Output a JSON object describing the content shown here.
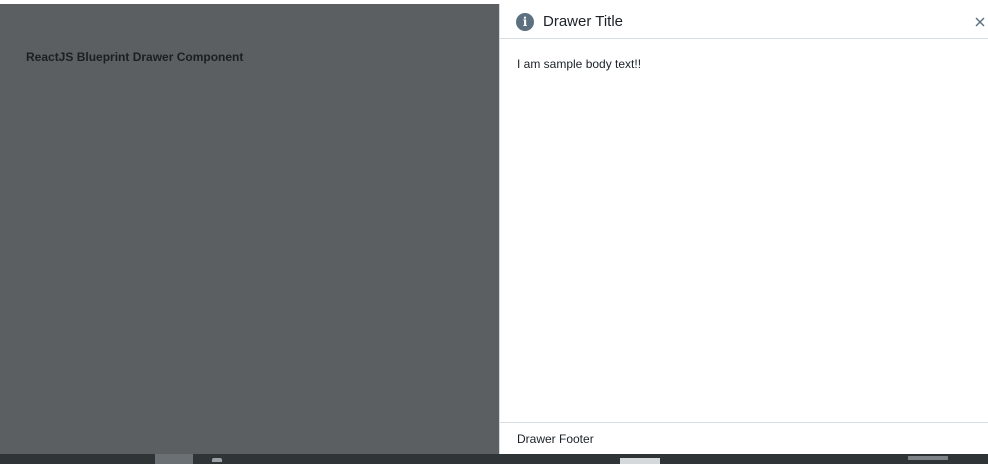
{
  "page": {
    "heading": "ReactJS Blueprint Drawer Component"
  },
  "drawer": {
    "title": "Drawer Title",
    "title_icon": "info-icon",
    "close_icon": "close-icon",
    "body_text": "I am sample body text!!",
    "footer_text": "Drawer Footer"
  },
  "colors": {
    "backdrop": "#5b5f61",
    "drawer_background": "#ffffff",
    "icon": "#5c7080",
    "taskbar": "#2f3437"
  }
}
